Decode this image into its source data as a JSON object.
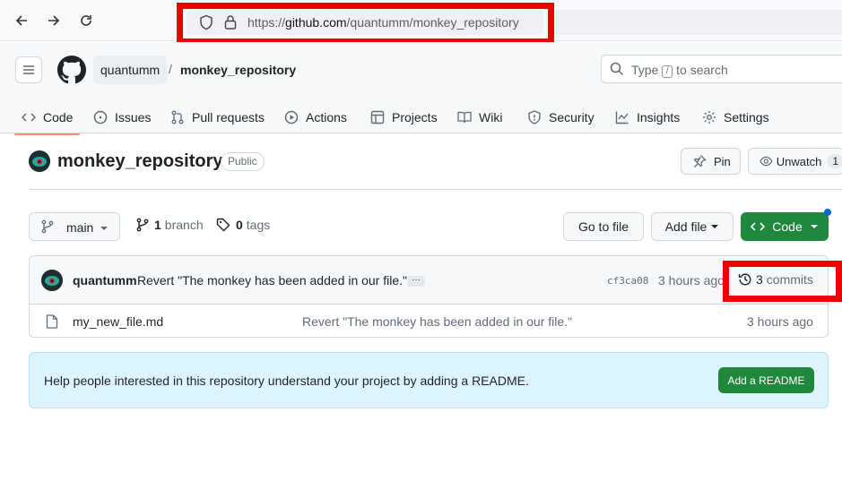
{
  "browser": {
    "url_prefix": "https://",
    "url_host": "github.com",
    "url_path": "/quantumm/monkey_repository"
  },
  "header": {
    "owner": "quantumm",
    "separator": "/",
    "repo": "monkey_repository",
    "search_placeholder_before": "Type",
    "search_kbd": "/",
    "search_placeholder_after": "to search"
  },
  "tabs": [
    {
      "label": "Code",
      "icon": "code-icon"
    },
    {
      "label": "Issues",
      "icon": "issue-icon"
    },
    {
      "label": "Pull requests",
      "icon": "pull-request-icon"
    },
    {
      "label": "Actions",
      "icon": "play-icon"
    },
    {
      "label": "Projects",
      "icon": "table-icon"
    },
    {
      "label": "Wiki",
      "icon": "book-icon"
    },
    {
      "label": "Security",
      "icon": "shield-icon"
    },
    {
      "label": "Insights",
      "icon": "graph-icon"
    },
    {
      "label": "Settings",
      "icon": "gear-icon"
    }
  ],
  "repo": {
    "title": "monkey_repository",
    "visibility": "Public",
    "pin_label": "Pin",
    "unwatch_label": "Unwatch",
    "watch_count": "1"
  },
  "toolbar": {
    "branch": "main",
    "branch_count": "1",
    "branch_label": "branch",
    "tag_count": "0",
    "tag_label": "tags",
    "go_to_file": "Go to file",
    "add_file": "Add file",
    "code": "Code"
  },
  "latest_commit": {
    "author": "quantumm",
    "message": "Revert \"The monkey has been added in our file.\"",
    "ellipsis": "…",
    "sha": "cf3ca08",
    "time": "3 hours ago",
    "commit_count": "3",
    "commit_label": "commits"
  },
  "files": [
    {
      "name": "my_new_file.md",
      "message": "Revert \"The monkey has been added in our file.\"",
      "time": "3 hours ago"
    }
  ],
  "readme_banner": {
    "text": "Help people interested in this repository understand your project by adding a README.",
    "button": "Add a README"
  },
  "colors": {
    "annotation_red": "#ee0000",
    "primary_green": "#1f883d",
    "tab_underline": "#fd8c73",
    "banner_blue": "#ddf4ff"
  }
}
